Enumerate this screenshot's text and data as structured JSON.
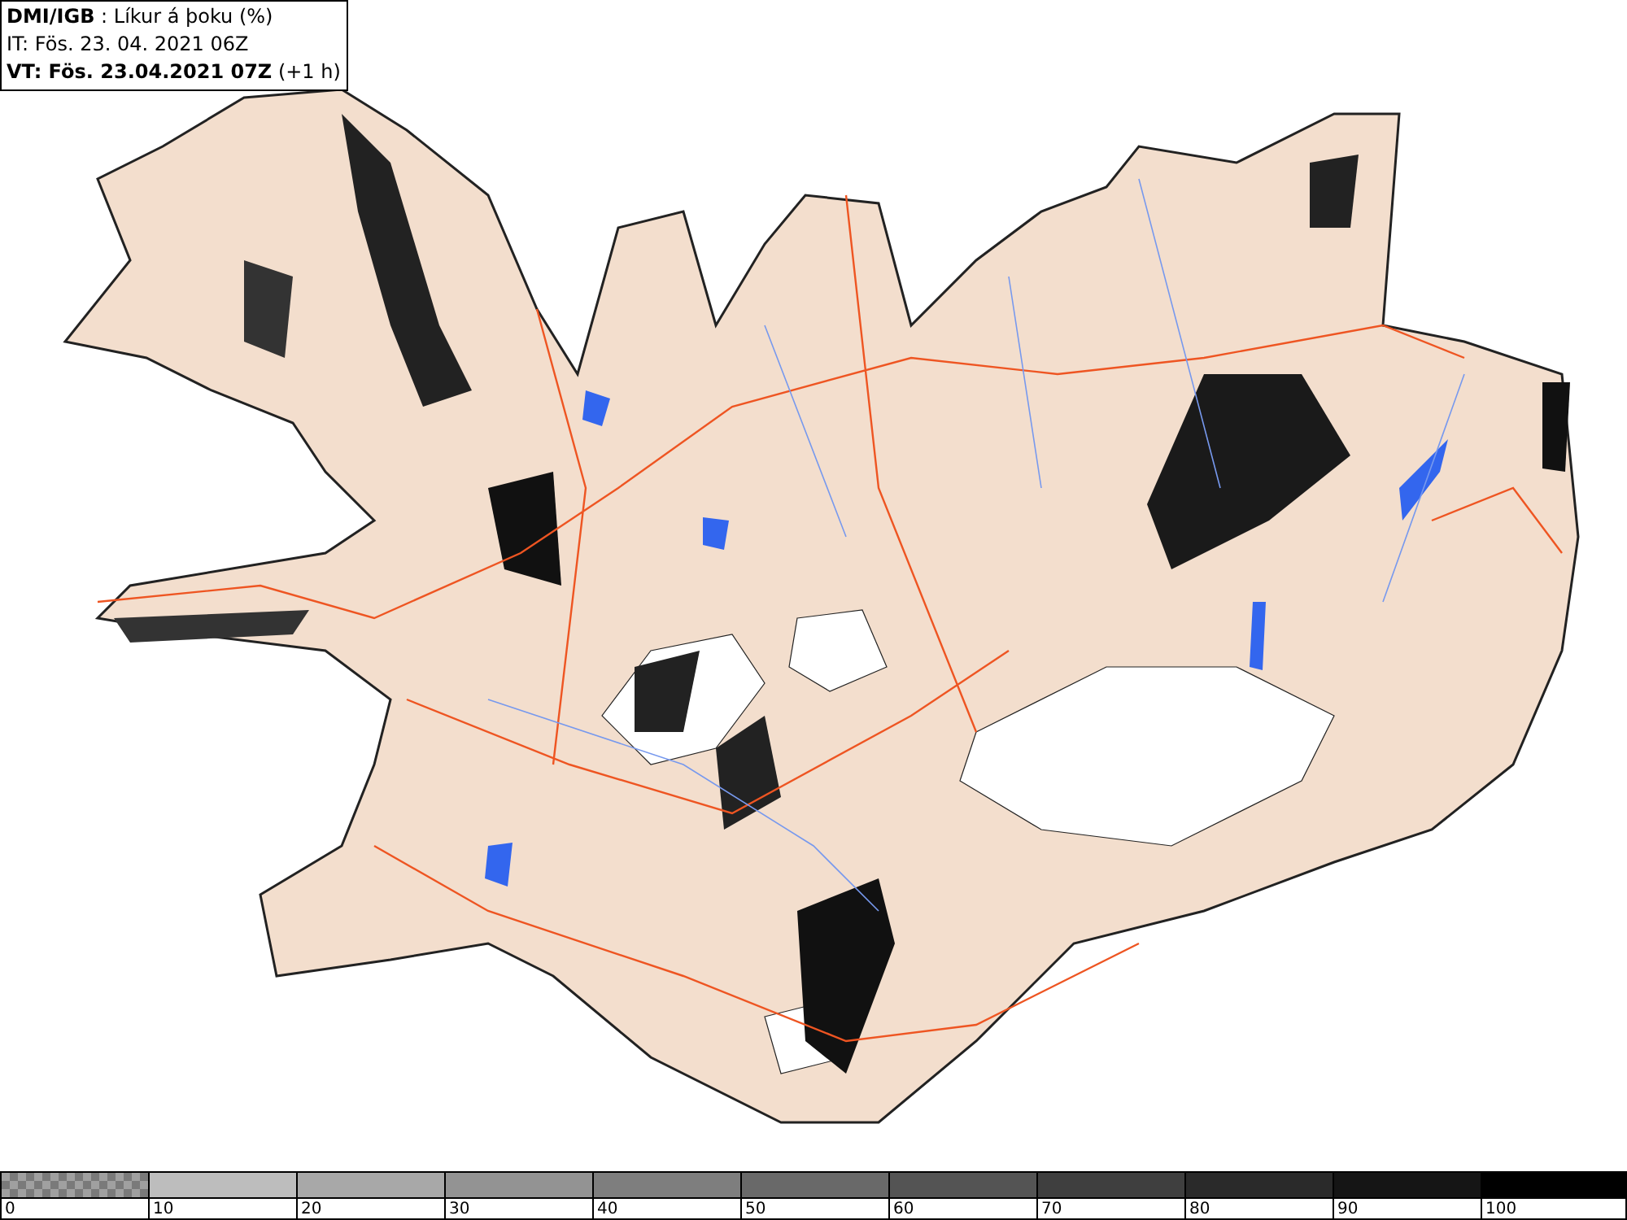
{
  "info_box": {
    "lines": [
      "**DMI/IGB** : Líkur á þoku (%)",
      "IT: Fös. 23. 04. 2021 06Z",
      "**VT: Fös. 23.04.2021 07Z** (+1 h)"
    ]
  },
  "legend": {
    "swatches": [
      {
        "kind": "checker",
        "color": "#7a7a7a"
      },
      {
        "kind": "solid",
        "color": "#bdbdbd"
      },
      {
        "kind": "solid",
        "color": "#a8a8a8"
      },
      {
        "kind": "solid",
        "color": "#939393"
      },
      {
        "kind": "solid",
        "color": "#7e7e7e"
      },
      {
        "kind": "solid",
        "color": "#696969"
      },
      {
        "kind": "solid",
        "color": "#545454"
      },
      {
        "kind": "solid",
        "color": "#3f3f3f"
      },
      {
        "kind": "solid",
        "color": "#2a2a2a"
      },
      {
        "kind": "solid",
        "color": "#151515"
      },
      {
        "kind": "solid",
        "color": "#000000"
      }
    ],
    "labels": [
      "0",
      "10",
      "20",
      "30",
      "40",
      "50",
      "60",
      "70",
      "80",
      "90",
      "100"
    ]
  }
}
